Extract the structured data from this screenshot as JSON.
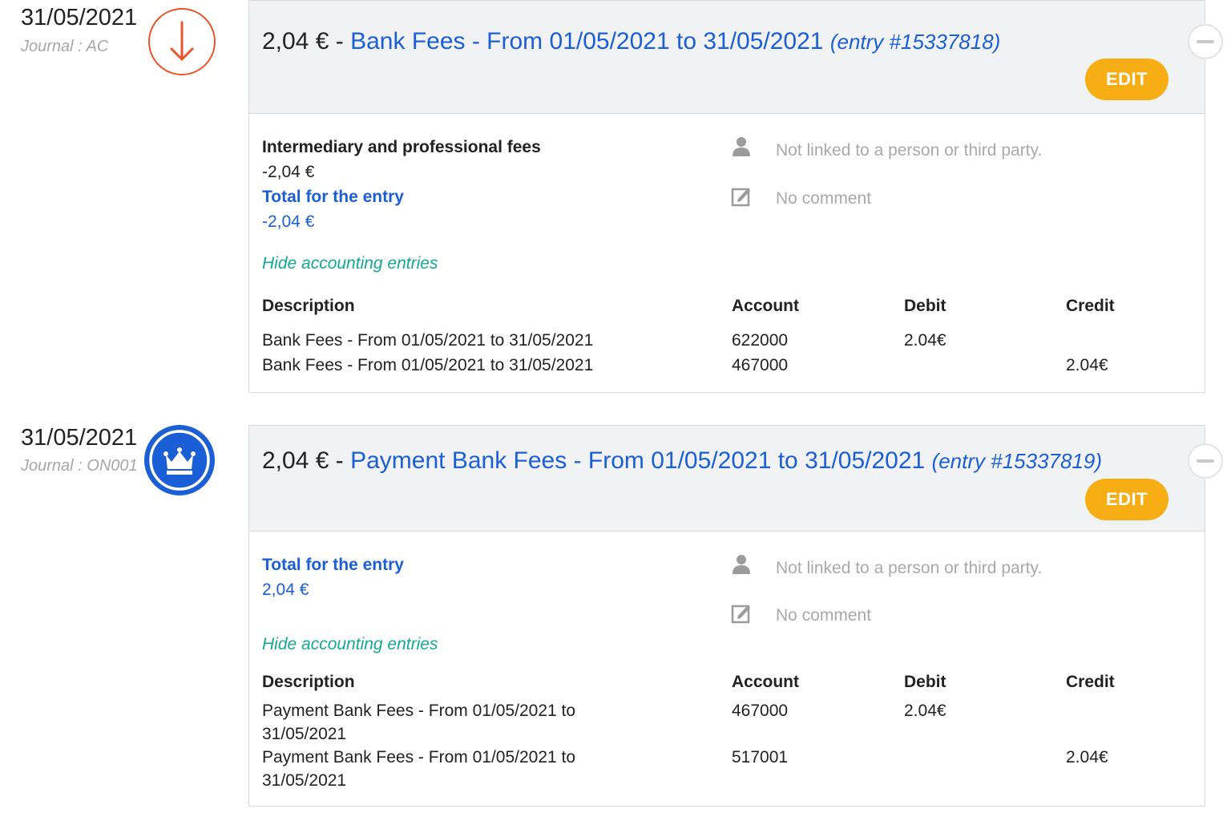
{
  "entries": [
    {
      "date": "31/05/2021",
      "journal": "Journal : AC",
      "icon": "arrow-down-icon",
      "amount": "2,04 €",
      "separator": "-",
      "title": "Bank Fees - From 01/05/2021 to 31/05/2021",
      "ref": "(entry #15337818)",
      "edit_label": "EDIT",
      "line_label": "Intermediary and professional fees",
      "line_amount": "-2,04 €",
      "total_label": "Total for the entry",
      "total_amount": "-2,04 €",
      "link_text": "Not linked to a person or third party.",
      "comment_text": "No comment",
      "hide_link": "Hide accounting entries",
      "headers": {
        "description": "Description",
        "account": "Account",
        "debit": "Debit",
        "credit": "Credit"
      },
      "rows": [
        {
          "description": "Bank Fees - From 01/05/2021 to 31/05/2021",
          "account": "622000",
          "debit": "2.04€",
          "credit": ""
        },
        {
          "description": "Bank Fees - From 01/05/2021 to 31/05/2021",
          "account": "467000",
          "debit": "",
          "credit": "2.04€"
        }
      ]
    },
    {
      "date": "31/05/2021",
      "journal": "Journal : ON001",
      "icon": "crown-icon",
      "amount": "2,04 €",
      "separator": "-",
      "title": "Payment Bank Fees - From 01/05/2021 to 31/05/2021",
      "ref": "(entry #15337819)",
      "edit_label": "EDIT",
      "total_label": "Total for the entry",
      "total_amount": "2,04 €",
      "link_text": "Not linked to a person or third party.",
      "comment_text": "No comment",
      "hide_link": "Hide accounting entries",
      "headers": {
        "description": "Description",
        "account": "Account",
        "debit": "Debit",
        "credit": "Credit"
      },
      "rows": [
        {
          "description": "Payment Bank Fees - From 01/05/2021 to 31/05/2021",
          "account": "467000",
          "debit": "2.04€",
          "credit": ""
        },
        {
          "description": "Payment Bank Fees - From 01/05/2021 to 31/05/2021",
          "account": "517001",
          "debit": "",
          "credit": "2.04€"
        }
      ]
    }
  ],
  "colors": {
    "accent_blue": "#1a5fd6",
    "edit_button": "#f7ae14",
    "arrow_icon": "#e8552a",
    "crown_icon": "#1a5fd6",
    "link_teal": "#13a896"
  }
}
